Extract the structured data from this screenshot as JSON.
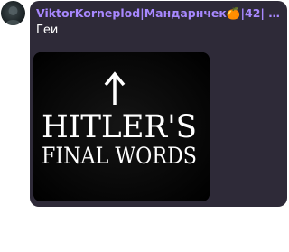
{
  "message": {
    "author": "ViktorKorneplod|Мандарнчек🍊|42| #мя...",
    "text": "Геи",
    "media": {
      "kind": "image",
      "lines": [
        "HITLER'S",
        "FINAL WORDS"
      ],
      "symbol": "up-arrow-icon"
    }
  },
  "colors": {
    "author": "#a888ff",
    "bubble": "#2e2a38",
    "text": "#ffffff",
    "media_background": "#000000"
  }
}
